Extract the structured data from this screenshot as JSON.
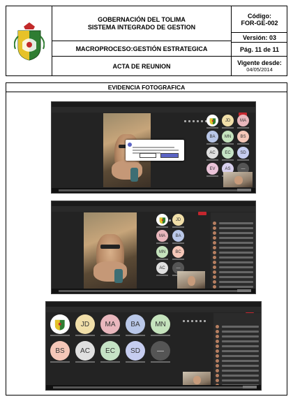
{
  "header": {
    "title_line1": "GOBERNACIÓN DEL TOLIMA",
    "title_line2": "SISTEMA INTEGRADO DE GESTION",
    "macro_label": "MACROPROCESO:",
    "macro_value": "GESTIÓN ESTRATEGICA",
    "acta": "ACTA DE REUNION",
    "codigo_label": "Código:",
    "codigo_value": "FOR-GE-002",
    "version": "Versión: 03",
    "pagina": "Pág. 11 de 11",
    "vigente_label": "Vigente desde:",
    "vigente_value": "04/05/2014"
  },
  "evidence": {
    "title": "EVIDENCIA FOTOGRAFICA"
  },
  "screenshots": [
    {
      "avatars": [
        {
          "initials": "",
          "color": "#ffffff"
        },
        {
          "initials": "JD",
          "color": "#f1dfa9"
        },
        {
          "initials": "MA",
          "color": "#e9b7bd"
        },
        {
          "initials": "BA",
          "color": "#b9c7e8"
        },
        {
          "initials": "MN",
          "color": "#c5e3bd"
        },
        {
          "initials": "BS",
          "color": "#f5c7b8"
        },
        {
          "initials": "AC",
          "color": "#e0e0e0"
        },
        {
          "initials": "EC",
          "color": "#c5e3c5"
        },
        {
          "initials": "SD",
          "color": "#c6cdf0"
        },
        {
          "initials": "EV",
          "color": "#eac3d8"
        },
        {
          "initials": "AS",
          "color": "#d8d0ee"
        },
        {
          "initials": "—",
          "color": "#555555"
        }
      ]
    },
    {
      "avatars": [
        {
          "initials": "",
          "color": "#ffffff"
        },
        {
          "initials": "JD",
          "color": "#f1dfa9"
        },
        {
          "initials": "MA",
          "color": "#e9b7bd"
        },
        {
          "initials": "BA",
          "color": "#b9c7e8"
        },
        {
          "initials": "MN",
          "color": "#c5e3bd"
        },
        {
          "initials": "BC",
          "color": "#f5c7b8"
        },
        {
          "initials": "AC",
          "color": "#e0e0e0"
        },
        {
          "initials": "—",
          "color": "#555555"
        }
      ]
    },
    {
      "avatars": [
        {
          "initials": "",
          "color": "#ffffff"
        },
        {
          "initials": "JD",
          "color": "#f1dfa9"
        },
        {
          "initials": "MA",
          "color": "#e9b7bd"
        },
        {
          "initials": "BA",
          "color": "#b9c7e8"
        },
        {
          "initials": "MN",
          "color": "#c5e3bd"
        },
        {
          "initials": "BS",
          "color": "#f5c7b8"
        },
        {
          "initials": "AC",
          "color": "#e0e0e0"
        },
        {
          "initials": "EC",
          "color": "#c5e3c5"
        },
        {
          "initials": "SD",
          "color": "#c6cdf0"
        },
        {
          "initials": "—",
          "color": "#555555"
        }
      ]
    }
  ],
  "colors": {
    "meeting_bg": "#232323",
    "leave_button": "#c4262e"
  }
}
